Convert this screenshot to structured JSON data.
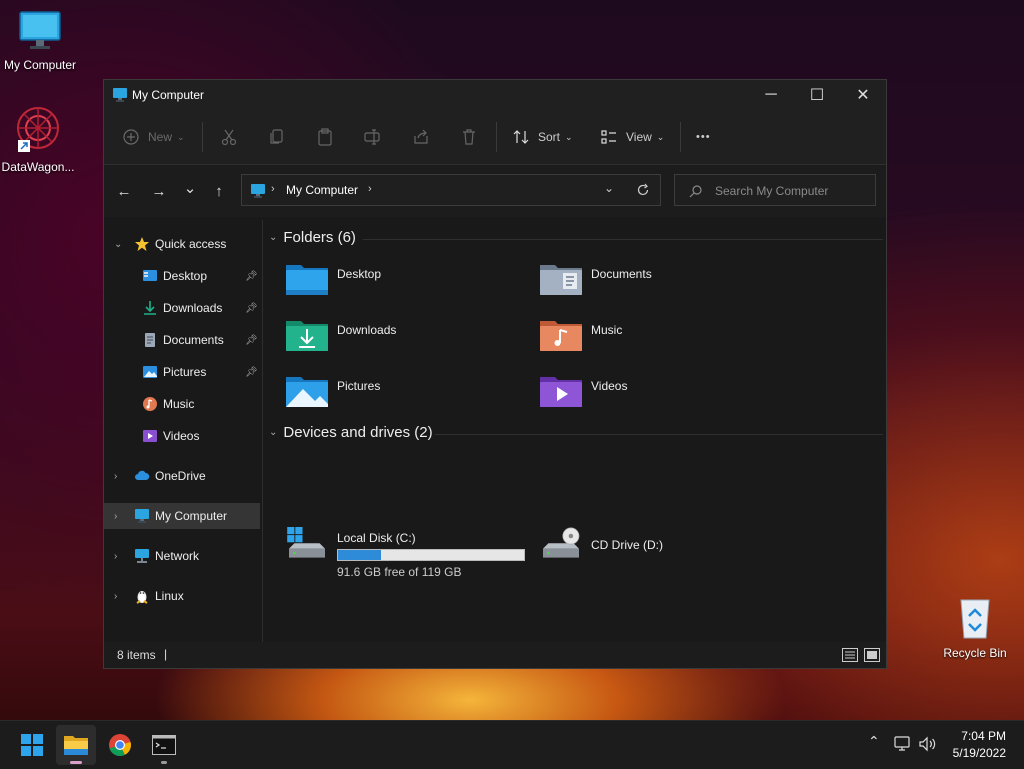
{
  "desktop": {
    "icons": [
      {
        "label": "My Computer",
        "icon": "monitor-icon"
      },
      {
        "label": "DataWagon...",
        "icon": "datawagon-app-icon"
      },
      {
        "label": "Recycle Bin",
        "icon": "recycle-bin-icon"
      }
    ]
  },
  "window": {
    "title": "My Computer",
    "controls": {
      "minimize": "─",
      "maximize": "☐",
      "close": "✕"
    }
  },
  "toolbar": {
    "new_label": "New",
    "sort_label": "Sort",
    "view_label": "View",
    "more_label": "•••"
  },
  "nav": {
    "back": "←",
    "forward": "→",
    "recent": "⌄",
    "up": "↑",
    "address": "My Computer",
    "search_placeholder": "Search My Computer"
  },
  "sidebar": {
    "items": [
      {
        "label": "Quick access",
        "icon": "star-icon"
      },
      {
        "label": "Desktop",
        "icon": "desktop-icon",
        "pinned": true
      },
      {
        "label": "Downloads",
        "icon": "download-icon",
        "pinned": true
      },
      {
        "label": "Documents",
        "icon": "document-icon",
        "pinned": true
      },
      {
        "label": "Pictures",
        "icon": "pictures-icon",
        "pinned": true
      },
      {
        "label": "Music",
        "icon": "music-icon"
      },
      {
        "label": "Videos",
        "icon": "videos-icon"
      },
      {
        "label": "OneDrive",
        "icon": "cloud-icon"
      },
      {
        "label": "My Computer",
        "icon": "monitor-icon",
        "selected": true
      },
      {
        "label": "Network",
        "icon": "network-icon"
      },
      {
        "label": "Linux",
        "icon": "linux-icon"
      }
    ]
  },
  "main": {
    "folders_header": "Folders (6)",
    "folders": [
      {
        "name": "Desktop",
        "color": "#1e90d8"
      },
      {
        "name": "Documents",
        "color": "#8d9db0"
      },
      {
        "name": "Downloads",
        "color": "#21b08a"
      },
      {
        "name": "Music",
        "color": "#e07850"
      },
      {
        "name": "Pictures",
        "color": "#2b8fe0"
      },
      {
        "name": "Videos",
        "color": "#8a4fd0"
      }
    ],
    "devices_header": "Devices and drives (2)",
    "drives": [
      {
        "name": "Local Disk (C:)",
        "free_text": "91.6 GB free of 119 GB",
        "used_fraction": 0.23
      },
      {
        "name": "CD Drive (D:)"
      }
    ]
  },
  "status": {
    "items_count": "8 items",
    "cursor": "|"
  },
  "taskbar": {
    "apps": [
      "start-icon",
      "file-explorer-icon",
      "chrome-icon",
      "terminal-icon"
    ],
    "time": "7:04 PM",
    "date": "5/19/2022"
  }
}
